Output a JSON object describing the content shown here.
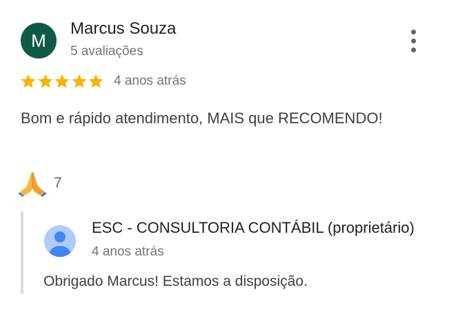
{
  "review": {
    "author": {
      "initial": "M",
      "name": "Marcus Souza",
      "reviews_count": "5 avaliações",
      "avatar_color": "#0f5a45"
    },
    "more_options_icon": "more-vert-icon",
    "rating": 5,
    "rating_max": 5,
    "star_color": "#f4b400",
    "date": "4 anos atrás",
    "text": "Bom e rápido atendimento, MAIS que RECOMENDO!",
    "reaction": {
      "icon": "folded-hands-icon",
      "count": "7"
    }
  },
  "owner_reply": {
    "name": "ESC - CONSULTORIA CONTÁBIL (proprietário)",
    "date": "4 anos atrás",
    "text": "Obrigado Marcus! Estamos a disposição.",
    "avatar_icon": "person-icon",
    "avatar_color": "#aecbfa",
    "avatar_figure_color": "#4285f4"
  }
}
